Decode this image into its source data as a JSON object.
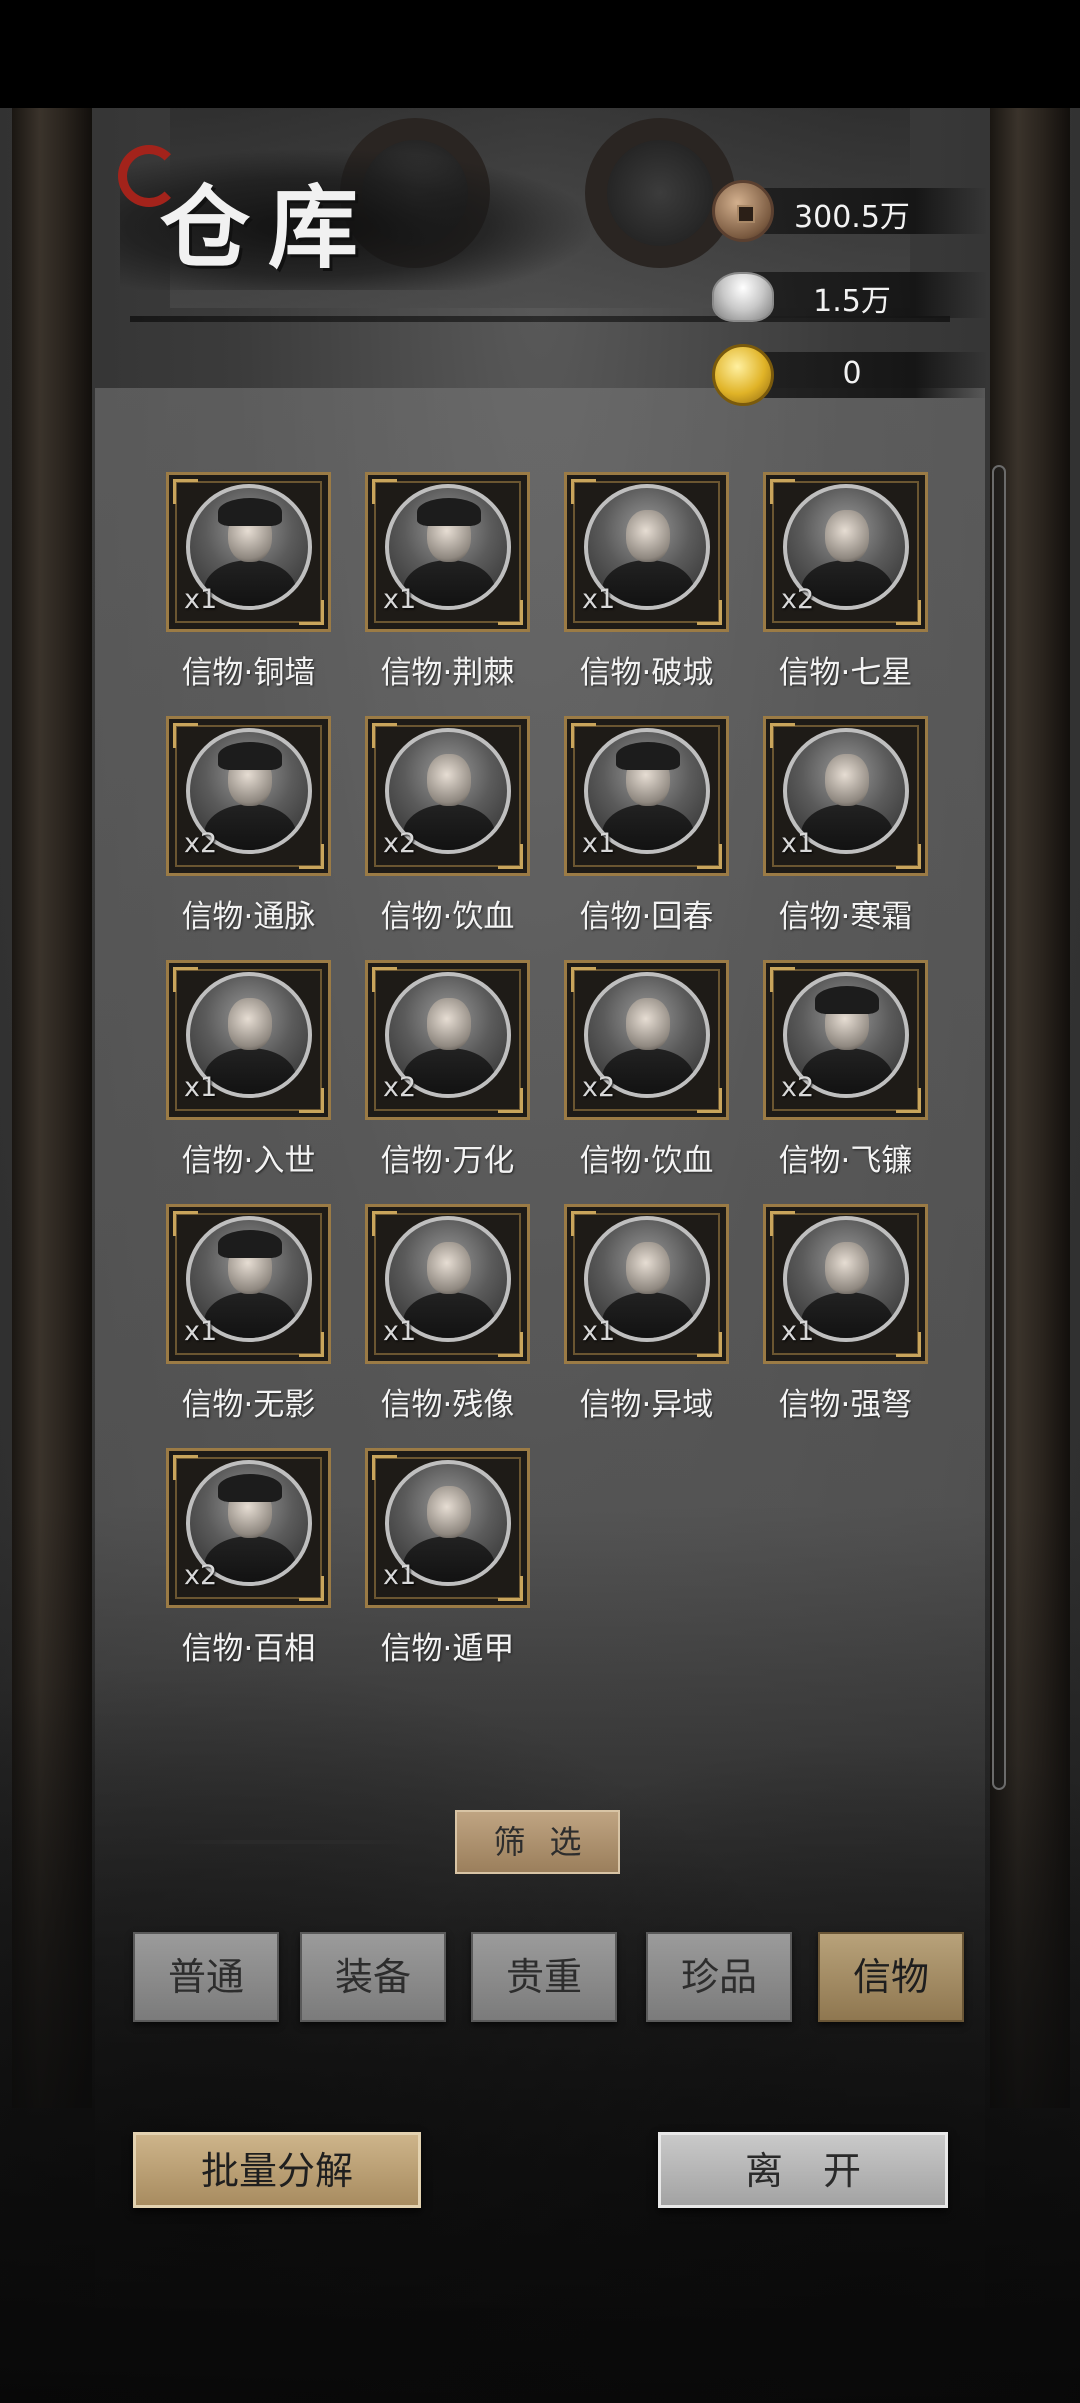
{
  "header": {
    "title": "仓库"
  },
  "currencies": [
    {
      "icon": "copper-coin-icon",
      "value": "300.5万"
    },
    {
      "icon": "silver-ingot-icon",
      "value": "1.5万"
    },
    {
      "icon": "gold-coin-icon",
      "value": "0"
    }
  ],
  "items": [
    {
      "name": "信物·铜墙",
      "qty": "x1"
    },
    {
      "name": "信物·荆棘",
      "qty": "x1"
    },
    {
      "name": "信物·破城",
      "qty": "x1"
    },
    {
      "name": "信物·七星",
      "qty": "x2"
    },
    {
      "name": "信物·通脉",
      "qty": "x2"
    },
    {
      "name": "信物·饮血",
      "qty": "x2"
    },
    {
      "name": "信物·回春",
      "qty": "x1"
    },
    {
      "name": "信物·寒霜",
      "qty": "x1"
    },
    {
      "name": "信物·入世",
      "qty": "x1"
    },
    {
      "name": "信物·万化",
      "qty": "x2"
    },
    {
      "name": "信物·饮血",
      "qty": "x2"
    },
    {
      "name": "信物·飞镰",
      "qty": "x2"
    },
    {
      "name": "信物·无影",
      "qty": "x1"
    },
    {
      "name": "信物·残像",
      "qty": "x1"
    },
    {
      "name": "信物·异域",
      "qty": "x1"
    },
    {
      "name": "信物·强弩",
      "qty": "x1"
    },
    {
      "name": "信物·百相",
      "qty": "x2"
    },
    {
      "name": "信物·遁甲",
      "qty": "x1"
    }
  ],
  "filter": {
    "label": "筛选",
    "tabs": [
      "普通",
      "装备",
      "贵重",
      "珍品",
      "信物"
    ],
    "active_tab": "信物"
  },
  "buttons": {
    "decompose": "批量分解",
    "leave": "离开"
  },
  "colors": {
    "accent_gold": "#b8a27a",
    "frame_gold": "#9b7b45"
  }
}
